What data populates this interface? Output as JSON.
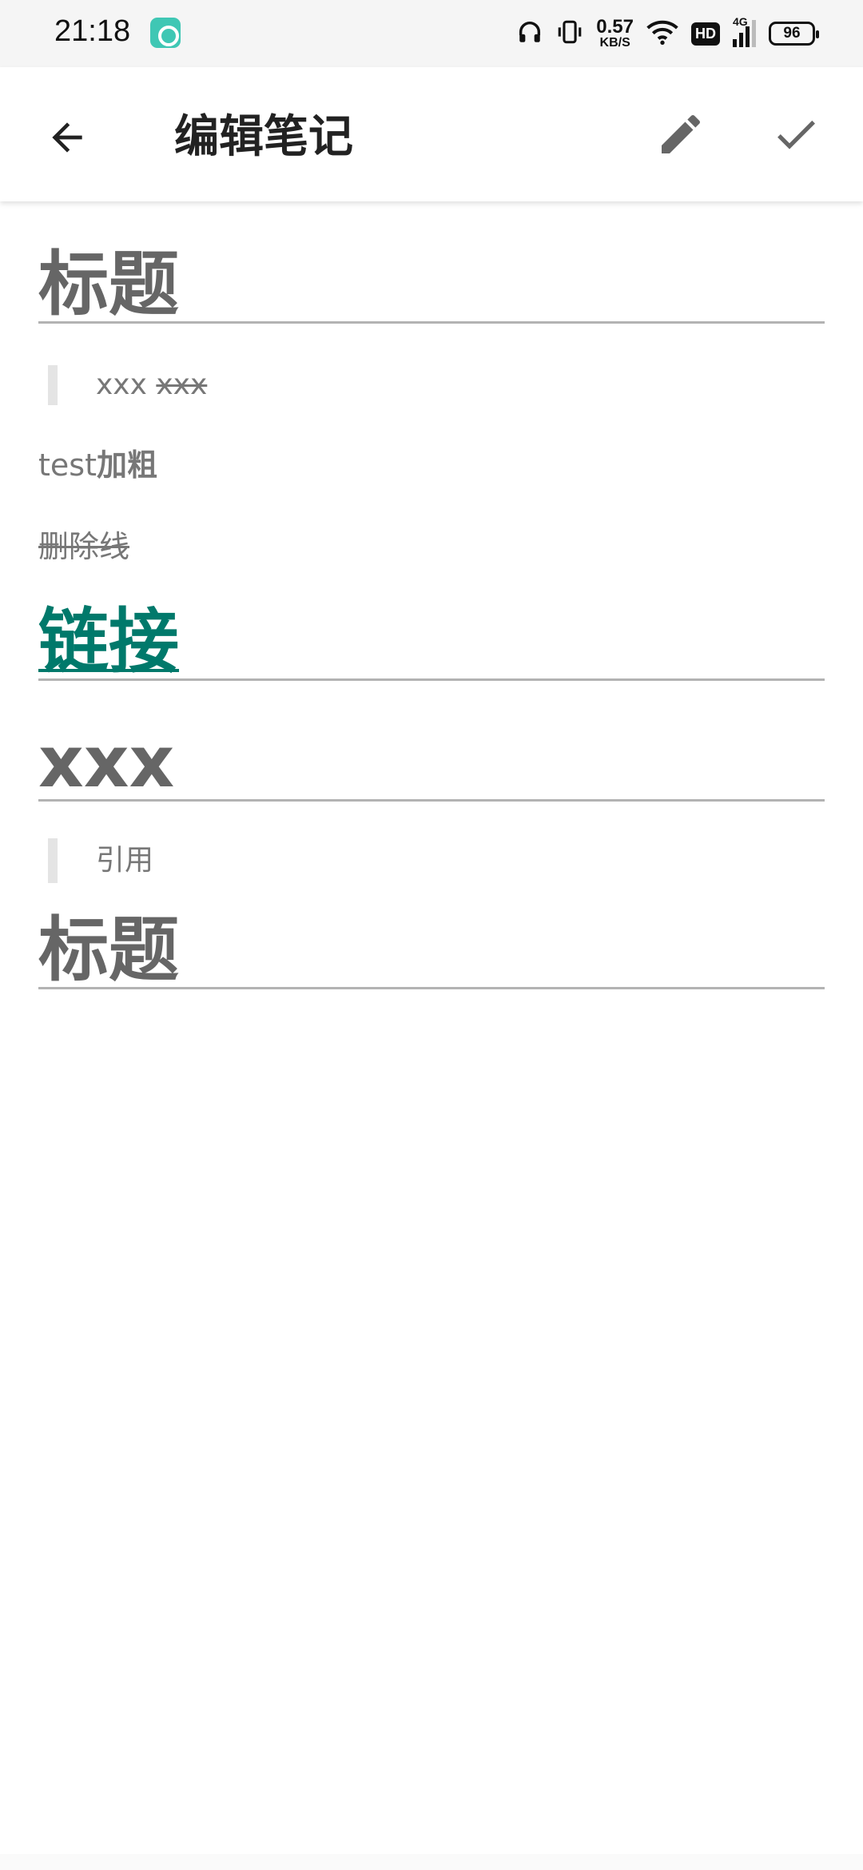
{
  "status_bar": {
    "time": "21:18",
    "net_speed_value": "0.57",
    "net_speed_unit": "KB/S",
    "hd_label": "HD",
    "network_label": "4G",
    "battery_level": "96",
    "icons": [
      "app-notification-icon",
      "headphones-icon",
      "vibrate-icon",
      "wifi-icon",
      "signal-icon",
      "battery-icon"
    ]
  },
  "app_bar": {
    "title": "编辑笔记",
    "icons": [
      "back-arrow-icon",
      "pencil-icon",
      "checkmark-icon"
    ]
  },
  "note": {
    "heading_1": "标题",
    "quote_1_plain": "xxx ",
    "quote_1_struck": "xxx",
    "para_bold_prefix": "test",
    "para_bold_text": "加粗",
    "para_strikethrough": "删除线",
    "link_heading": "链接",
    "heading_2": "xxx",
    "quote_2": "引用",
    "heading_3": "标题"
  },
  "colors": {
    "accent_link": "#00796b",
    "text_muted": "#777777",
    "heading_text": "#666666",
    "divider": "#b3b3b3",
    "quote_bar": "#e4e4e4"
  }
}
